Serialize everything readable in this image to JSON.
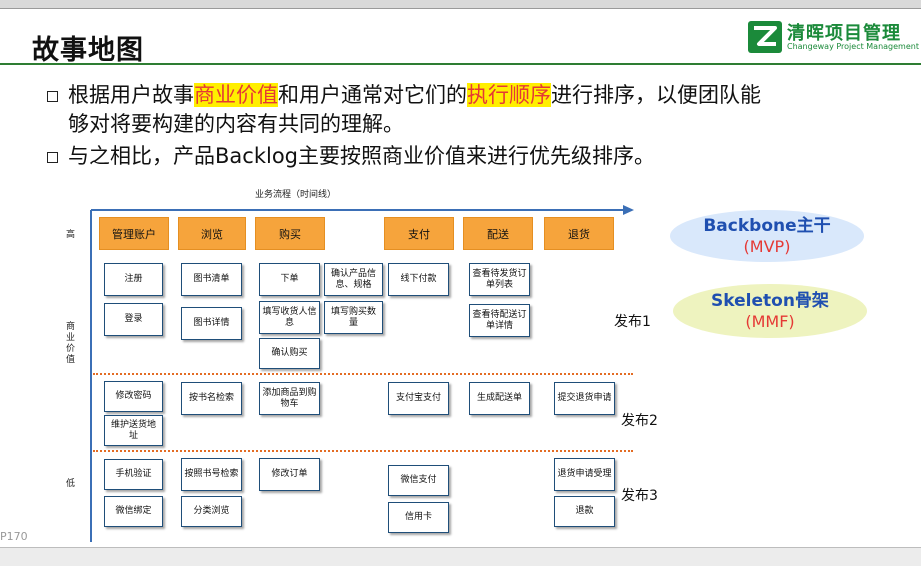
{
  "header": {
    "title": "故事地图",
    "logo_cn": "清晖项目管理",
    "logo_en": "Changeway Project Management",
    "logo_icon": "z-logo-icon"
  },
  "bullets": {
    "b1_a": "根据用户故事",
    "b1_h1": "商业价值",
    "b1_b": "和用户通常对它们的",
    "b1_h2": "执行顺序",
    "b1_c": "进行排序，以便团队能",
    "b1_line2": "够对将要构建的内容有共同的理解。",
    "b2": "与之相比，产品Backlog主要按照商业价值来进行优先级排序。"
  },
  "diagram": {
    "flow_label": "业务流程（时间线）",
    "y_high": "高",
    "y_mid": "商业价值",
    "y_low": "低",
    "categories": [
      "管理账户",
      "浏览",
      "购买",
      "支付",
      "配送",
      "退货"
    ],
    "stories": {
      "s1": "注册",
      "s2": "登录",
      "s3": "图书清单",
      "s4": "图书详情",
      "s5": "下单",
      "s6": "确认产品信息、规格",
      "s7": "填写收货人信息",
      "s8": "填写购买数量",
      "s9": "确认购买",
      "s10": "线下付款",
      "s11": "查看待发货订单列表",
      "s12": "查看待配送订单详情",
      "s13": "修改密码",
      "s14": "维护送货地址",
      "s15": "按书名检索",
      "s16": "添加商品到购物车",
      "s17": "支付宝支付",
      "s18": "生成配送单",
      "s19": "提交退货申请",
      "s20": "手机验证",
      "s21": "微信绑定",
      "s22": "按照书号检索",
      "s23": "分类浏览",
      "s24": "修改订单",
      "s25": "微信支付",
      "s26": "信用卡",
      "s27": "退货申请受理",
      "s28": "退款"
    },
    "releases": [
      "发布1",
      "发布2",
      "发布3"
    ],
    "backbone": {
      "title": "Backbone主干",
      "sub": "(MVP)"
    },
    "skeleton": {
      "title": "Skeleton骨架",
      "sub": "(MMF)"
    }
  },
  "footer": {
    "page": "P170"
  },
  "colors": {
    "accent_green": "#1b8a3a",
    "highlight_yellow": "#ffef00",
    "highlight_red": "#e53935",
    "category_orange": "#f6a43c",
    "axis_blue": "#3b6fb6",
    "release_line": "#e36c24"
  }
}
